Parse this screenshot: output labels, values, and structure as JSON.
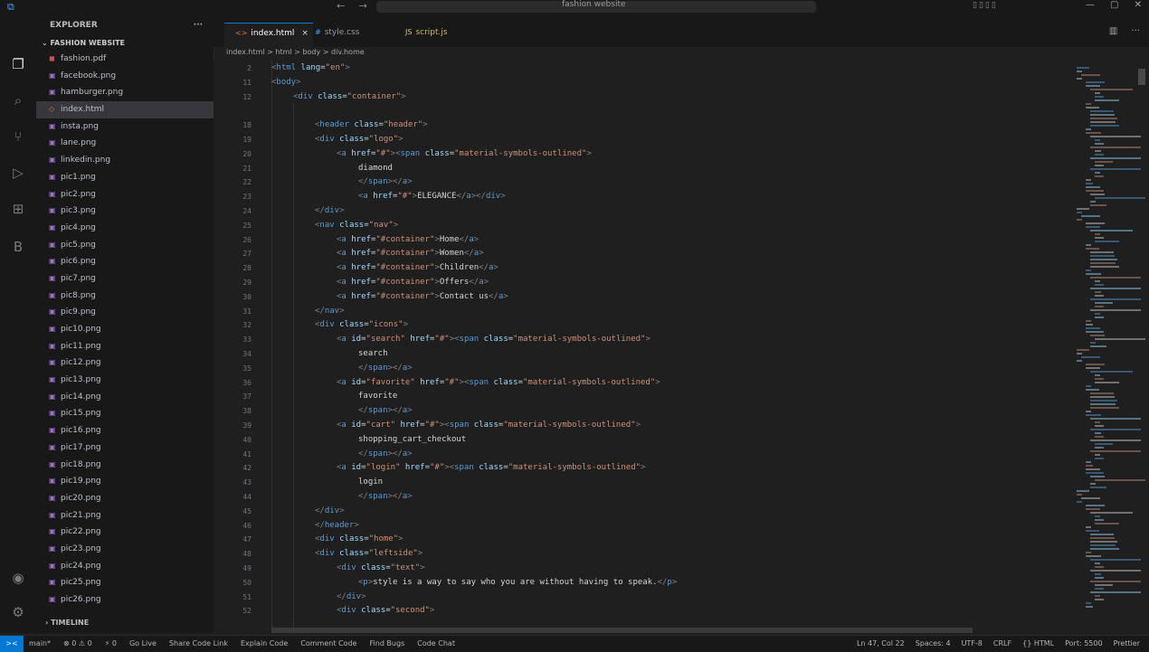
{
  "window": {
    "search_text": "fashion website",
    "nav_back": "←",
    "nav_forward": "→"
  },
  "sidebar": {
    "header": "EXPLORER",
    "more": "···",
    "project": "FASHION WEBSITE",
    "files": [
      {
        "name": "fashion.pdf",
        "type": "pdf"
      },
      {
        "name": "facebook.png",
        "type": "img"
      },
      {
        "name": "hamburger.png",
        "type": "img"
      },
      {
        "name": "index.html",
        "type": "htm",
        "selected": true
      },
      {
        "name": "insta.png",
        "type": "img"
      },
      {
        "name": "lane.png",
        "type": "img"
      },
      {
        "name": "linkedin.png",
        "type": "img"
      },
      {
        "name": "pic1.png",
        "type": "img"
      },
      {
        "name": "pic2.png",
        "type": "img"
      },
      {
        "name": "pic3.png",
        "type": "img"
      },
      {
        "name": "pic4.png",
        "type": "img"
      },
      {
        "name": "pic5.png",
        "type": "img"
      },
      {
        "name": "pic6.png",
        "type": "img"
      },
      {
        "name": "pic7.png",
        "type": "img"
      },
      {
        "name": "pic8.png",
        "type": "img"
      },
      {
        "name": "pic9.png",
        "type": "img"
      },
      {
        "name": "pic10.png",
        "type": "img"
      },
      {
        "name": "pic11.png",
        "type": "img"
      },
      {
        "name": "pic12.png",
        "type": "img"
      },
      {
        "name": "pic13.png",
        "type": "img"
      },
      {
        "name": "pic14.png",
        "type": "img"
      },
      {
        "name": "pic15.png",
        "type": "img"
      },
      {
        "name": "pic16.png",
        "type": "img"
      },
      {
        "name": "pic17.png",
        "type": "img"
      },
      {
        "name": "pic18.png",
        "type": "img"
      },
      {
        "name": "pic19.png",
        "type": "img"
      },
      {
        "name": "pic20.png",
        "type": "img"
      },
      {
        "name": "pic21.png",
        "type": "img"
      },
      {
        "name": "pic22.png",
        "type": "img"
      },
      {
        "name": "pic23.png",
        "type": "img"
      },
      {
        "name": "pic24.png",
        "type": "img"
      },
      {
        "name": "pic25.png",
        "type": "img"
      },
      {
        "name": "pic26.png",
        "type": "img"
      }
    ],
    "timeline": "TIMELINE"
  },
  "tabs": [
    {
      "label": "index.html",
      "icon": "<>",
      "close": "×",
      "active": true
    },
    {
      "label": "style.css",
      "icon": "#"
    },
    {
      "label": "script.js",
      "icon": "JS"
    }
  ],
  "breadcrumb": "index.html > html > body > div.home",
  "editor": {
    "lines": [
      {
        "n": "2",
        "indent": 0,
        "code": "<html lang=\"en\">"
      },
      {
        "n": "11",
        "indent": 0,
        "code": "<body>"
      },
      {
        "n": "12",
        "indent": 1,
        "code": "<div class=\"container\">"
      },
      {
        "n": "",
        "indent": 0,
        "code": ""
      },
      {
        "n": "18",
        "indent": 2,
        "code": "<header class=\"header\">"
      },
      {
        "n": "19",
        "indent": 2,
        "code": "<div class=\"logo\">"
      },
      {
        "n": "20",
        "indent": 3,
        "code": "<a href=\"#\"><span class=\"material-symbols-outlined\">"
      },
      {
        "n": "21",
        "indent": 4,
        "code": "diamond"
      },
      {
        "n": "22",
        "indent": 4,
        "code": "</span></a>"
      },
      {
        "n": "23",
        "indent": 4,
        "code": "<a href=\"#\">ELEGANCE</a></div>"
      },
      {
        "n": "24",
        "indent": 2,
        "code": "</div>"
      },
      {
        "n": "25",
        "indent": 2,
        "code": "<nav class=\"nav\">"
      },
      {
        "n": "26",
        "indent": 3,
        "code": "<a href=\"#container\">Home</a>"
      },
      {
        "n": "27",
        "indent": 3,
        "code": "<a href=\"#container\">Women</a>"
      },
      {
        "n": "28",
        "indent": 3,
        "code": "<a href=\"#container\">Children</a>"
      },
      {
        "n": "29",
        "indent": 3,
        "code": "<a href=\"#container\">Offers</a>"
      },
      {
        "n": "30",
        "indent": 3,
        "code": "<a href=\"#container\">Contact us</a>"
      },
      {
        "n": "31",
        "indent": 2,
        "code": "</nav>"
      },
      {
        "n": "32",
        "indent": 2,
        "code": "<div class=\"icons\">"
      },
      {
        "n": "33",
        "indent": 3,
        "code": "<a id=\"search\" href=\"#\"><span class=\"material-symbols-outlined\">"
      },
      {
        "n": "34",
        "indent": 4,
        "code": "search"
      },
      {
        "n": "35",
        "indent": 4,
        "code": "</span></a>"
      },
      {
        "n": "36",
        "indent": 3,
        "code": "<a id=\"favorite\" href=\"#\"><span class=\"material-symbols-outlined\">"
      },
      {
        "n": "37",
        "indent": 4,
        "code": "favorite"
      },
      {
        "n": "38",
        "indent": 4,
        "code": "</span></a>"
      },
      {
        "n": "39",
        "indent": 3,
        "code": "<a id=\"cart\" href=\"#\"><span class=\"material-symbols-outlined\">"
      },
      {
        "n": "40",
        "indent": 4,
        "code": "shopping_cart_checkout"
      },
      {
        "n": "41",
        "indent": 4,
        "code": "</span></a>"
      },
      {
        "n": "42",
        "indent": 3,
        "code": "<a id=\"login\" href=\"#\"><span class=\"material-symbols-outlined\">"
      },
      {
        "n": "43",
        "indent": 4,
        "code": "login"
      },
      {
        "n": "44",
        "indent": 4,
        "code": "</span></a>"
      },
      {
        "n": "45",
        "indent": 2,
        "code": "</div>"
      },
      {
        "n": "46",
        "indent": 2,
        "code": "</header>"
      },
      {
        "n": "47",
        "indent": 2,
        "code": "<div class=\"home\">"
      },
      {
        "n": "48",
        "indent": 2,
        "code": "<div class=\"leftside\">"
      },
      {
        "n": "49",
        "indent": 3,
        "code": "<div class=\"text\">"
      },
      {
        "n": "50",
        "indent": 4,
        "code": "<p>style is a way to say who you are without having to speak.</p>"
      },
      {
        "n": "51",
        "indent": 3,
        "code": "</div>"
      },
      {
        "n": "52",
        "indent": 3,
        "code": "<div class=\"second\">"
      }
    ]
  },
  "statusbar": {
    "remote": "><",
    "left": [
      "main*",
      "⊗ 0 ⚠ 0",
      "⚡ 0",
      "Go Live",
      "Share Code Link",
      "Explain Code",
      "Comment Code",
      "Find Bugs",
      "Code Chat"
    ],
    "right": [
      "Ln 47, Col 22",
      "Spaces: 4",
      "UTF-8",
      "CRLF",
      "{} HTML",
      "Port: 5500",
      "Prettier"
    ]
  },
  "colors": {
    "tag": "#569cd6",
    "attr": "#9cdcfe",
    "string": "#ce9178",
    "text": "#d4d4d4",
    "punct": "#808080",
    "accent": "#0078d4"
  }
}
